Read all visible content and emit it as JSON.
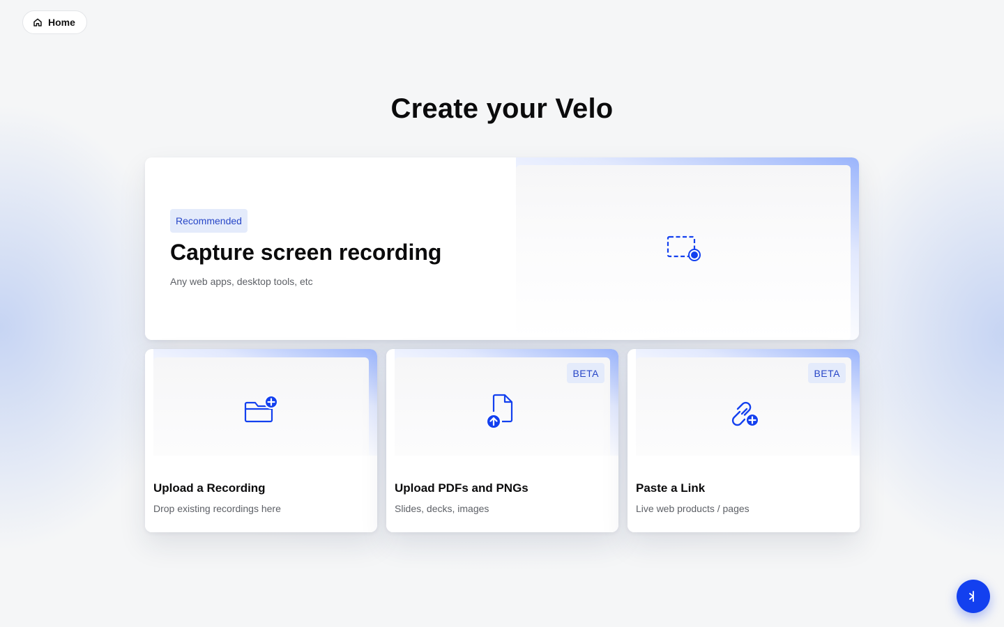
{
  "nav": {
    "home_label": "Home",
    "home_icon": "home-icon"
  },
  "page": {
    "title": "Create your Velo"
  },
  "colors": {
    "accent": "#1340ef",
    "badge_bg": "#e4ebfb",
    "badge_text": "#2746c7",
    "background": "#f5f6f7"
  },
  "capture_card": {
    "badge": "Recommended",
    "title": "Capture screen recording",
    "subtitle": "Any web apps, desktop tools, etc",
    "icon": "screen-record-icon"
  },
  "cards": [
    {
      "title": "Upload a Recording",
      "subtitle": "Drop existing recordings here",
      "icon": "folder-add-icon",
      "badge": ""
    },
    {
      "title": "Upload PDFs and PNGs",
      "subtitle": "Slides, decks, images",
      "icon": "file-upload-icon",
      "badge": "BETA"
    },
    {
      "title": "Paste a Link",
      "subtitle": "Live web products / pages",
      "icon": "link-add-icon",
      "badge": "BETA"
    }
  ],
  "fab": {
    "icon": "assistant-icon"
  }
}
